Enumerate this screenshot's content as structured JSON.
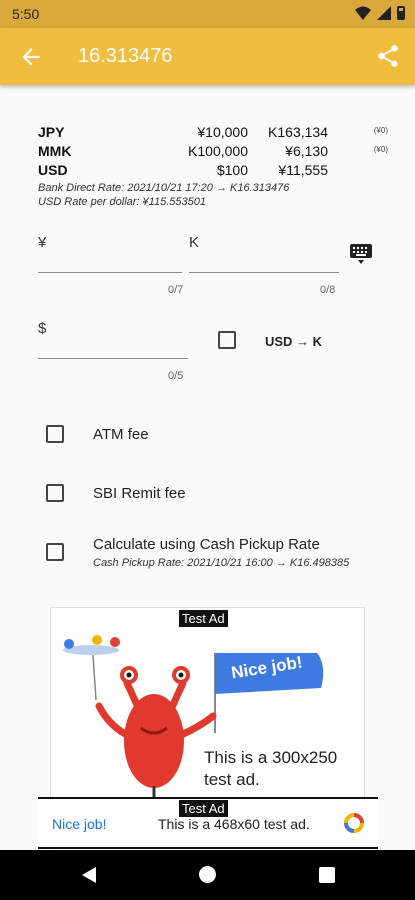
{
  "status_bar": {
    "time": "5:50"
  },
  "app_bar": {
    "title": "16.313476",
    "back_icon": "arrow-back-icon",
    "share_icon": "share-icon"
  },
  "rates": {
    "rows": [
      {
        "code": "JPY",
        "yen": "¥10,000",
        "k": "K163,134",
        "note": "(¥0)"
      },
      {
        "code": "MMK",
        "yen": "K100,000",
        "k": "¥6,130",
        "note": "(¥0)"
      },
      {
        "code": "USD",
        "yen": "$100",
        "k": "¥11,555",
        "note": ""
      }
    ],
    "bank_direct_rate": "Bank Direct Rate: 2021/10/21 17:20 → K16.313476",
    "usd_rate": "USD Rate per dollar: ¥115.553501"
  },
  "inputs": {
    "yen_label": "¥",
    "k_label": "K",
    "yen_counter": "0/7",
    "k_counter": "0/8",
    "usd_label": "$",
    "usd_counter": "0/5",
    "keyboard_icon": "keyboard-icon"
  },
  "options": {
    "usd_to_k": "USD → K",
    "atm_fee": "ATM fee",
    "sbi_remit_fee": "SBI Remit fee",
    "cash_pickup": "Calculate using Cash Pickup Rate",
    "cash_pickup_note": "Cash Pickup Rate: 2021/10/21 16:00 → K16.498385"
  },
  "ad": {
    "tag": "Test Ad",
    "flag_text": "Nice job!",
    "body_line1": "This is a 300x250",
    "body_line2": "test ad."
  },
  "banner": {
    "tag": "Test Ad",
    "nice": "Nice job!",
    "text": "This is a 468x60 test ad."
  },
  "colors": {
    "status_bar": "#d8a83a",
    "app_bar": "#f1bd3f",
    "flag": "#3d7be0"
  }
}
